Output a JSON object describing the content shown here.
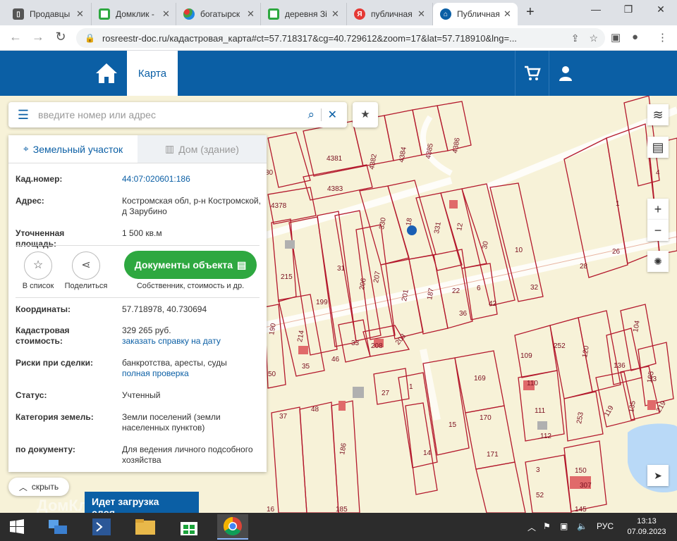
{
  "browser": {
    "tabs": [
      {
        "title": "Продавцы",
        "icon": "generic-page-icon"
      },
      {
        "title": "Домклик -",
        "icon": "domclick-icon"
      },
      {
        "title": "богатырск",
        "icon": "colorful-dots-icon"
      },
      {
        "title": "деревня Зі",
        "icon": "domclick-icon"
      },
      {
        "title": "публичная",
        "icon": "yandex-icon"
      },
      {
        "title": "Публичная",
        "icon": "home-icon"
      }
    ],
    "new_tab": "+",
    "url": "rosreestr-doc.ru/кадастровая_карта#ct=57.718317&cg=40.729612&zoom=17&lat=57.718910&lng=..."
  },
  "site": {
    "nav_map": "Карта",
    "colors": {
      "primary": "#0b5fa5",
      "button_green": "#2ea840",
      "parcel_line": "#b3182c",
      "map_bg": "#f7f2d8"
    }
  },
  "search": {
    "placeholder": "введите номер или адрес"
  },
  "panel": {
    "tab_land": "Земельный участок",
    "tab_house": "Дом (здание)",
    "rows_top": [
      {
        "key": "Кад.номер:",
        "value": "44:07:020601:186"
      },
      {
        "key": "Адрес:",
        "value": "Костромская обл, р-н Костромской, д Зарубино"
      },
      {
        "key": "Уточненная площадь:",
        "value": "1 500 кв.м"
      }
    ],
    "actions": {
      "save": "В список",
      "share": "Поделиться",
      "docs_button": "Документы объекта",
      "docs_caption": "Собственник, стоимость и др."
    },
    "coords": {
      "key": "Координаты:",
      "value": "57.718978, 40.730694"
    },
    "cadastral_cost": {
      "key": "Кадастровая стоимость:",
      "value": "329 265 руб.",
      "link": "заказать справку на дату"
    },
    "risks": {
      "key": "Риски при сделки:",
      "value": "банкротства, аресты, суды",
      "link": "полная проверка"
    },
    "status": {
      "key": "Статус:",
      "value": "Учтенный"
    },
    "land_category": {
      "key": "Категория земель:",
      "value": "Земли поселений (земли населенных пунктов)"
    },
    "by_document": {
      "key": "по документу:",
      "value": "Для ведения личного подсобного хозяйства"
    }
  },
  "hide_button": "скрыть",
  "loading_text": "Идет загрузка слоя...",
  "watermark": "ДомКлик",
  "map_labels": [
    "4381",
    "4382",
    "4384",
    "4385",
    "4386",
    "4383",
    "4378",
    "80",
    "330",
    "18",
    "331",
    "12",
    "30",
    "10",
    "1",
    "4",
    "215",
    "31",
    "206",
    "207",
    "201",
    "187",
    "22",
    "6",
    "199",
    "190",
    "214",
    "33",
    "208",
    "203",
    "35",
    "46",
    "109",
    "252",
    "120",
    "136",
    "104",
    "105",
    "110",
    "111",
    "112",
    "253",
    "119",
    "135",
    "219",
    "27",
    "1",
    "169",
    "170",
    "15",
    "14",
    "171",
    "186",
    "48",
    "37",
    "150",
    "307",
    "52",
    "3",
    "145",
    "26",
    "28",
    "32",
    "36",
    "42",
    "13",
    "50",
    "16",
    "185"
  ],
  "map_controls": {
    "zoom_in": "+",
    "zoom_out": "−"
  },
  "taskbar": {
    "language": "РУС",
    "time": "13:13",
    "date": "07.09.2023"
  }
}
